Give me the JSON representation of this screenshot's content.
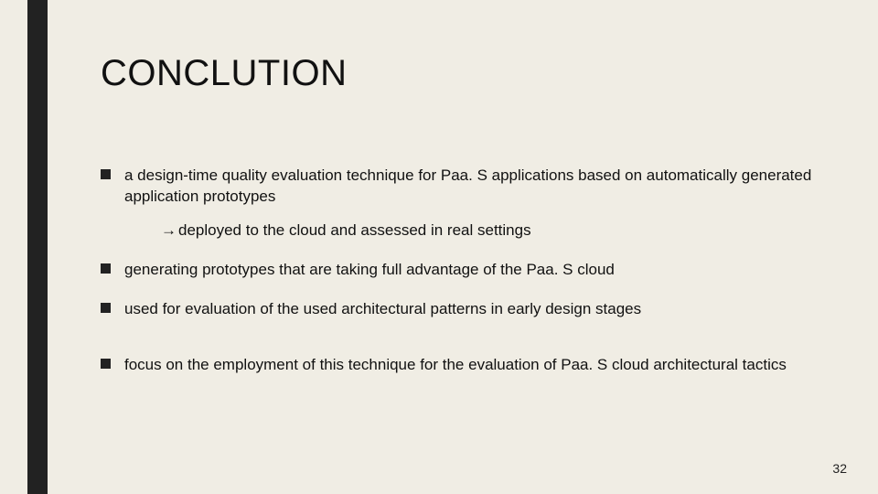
{
  "slide": {
    "title": "CONCLUTION",
    "bullets": [
      {
        "text": "a design-time quality evaluation technique for Paa. S applications based on automatically generated application prototypes",
        "sub": "deployed to the cloud and assessed in real settings"
      },
      {
        "text": "generating prototypes that are taking full advantage of the Paa. S cloud"
      },
      {
        "text": "used for evaluation of the used architectural patterns in early design stages"
      },
      {
        "text": "focus on the employment of this technique for the evaluation of Paa. S cloud architectural tactics",
        "gap": true
      }
    ],
    "arrow": "→",
    "page_number": "32"
  }
}
